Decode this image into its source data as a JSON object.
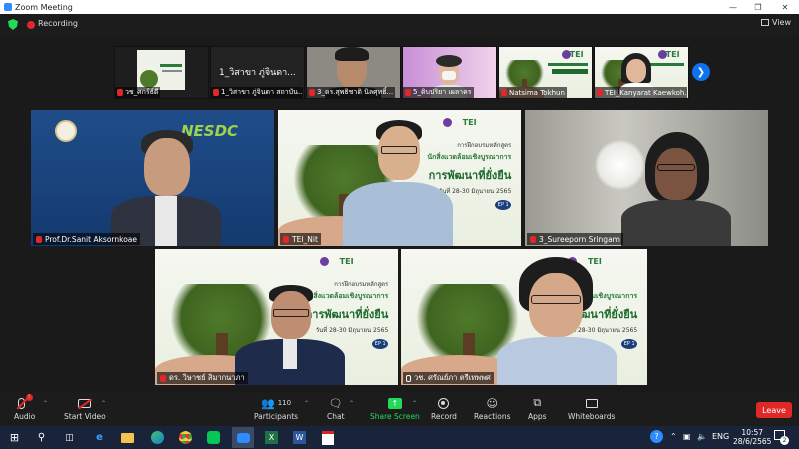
{
  "window": {
    "title": "Zoom Meeting"
  },
  "topbar": {
    "recording": "Recording",
    "view": "View"
  },
  "thumbnails": [
    {
      "name": "วช_ศกร์ธ์ดี"
    },
    {
      "name": "1_วิสาขา ภู่จินดา สถาบัน...",
      "display": "1_วิสาขา ภู่จินดา..."
    },
    {
      "name": "3_ดร.สุพธิชาติ นิลศุทธิ์..."
    },
    {
      "name": "5_ดิบปริยา เผลาคร"
    },
    {
      "name": "Natsima Tokhun"
    },
    {
      "name": "TEI_Kanyarat Kaewkoh..."
    }
  ],
  "tiles": [
    {
      "name": "Prof.Dr.Sanit Aksornkoae",
      "logo": "NESDC"
    },
    {
      "name": "TEI_Nit"
    },
    {
      "name": "3_Sureeporn Sringam"
    },
    {
      "name": "ดร. วิษาชย์ สิมากนาภา"
    },
    {
      "name": "วช. ศรัณย์ภา ตรีเทพพศ"
    }
  ],
  "slide": {
    "line1": "การฝึกอบรมหลักสูตร",
    "line2": "นักสิ่งแวดล้อมเชิงบูรณาการ",
    "line3": "การพัฒนาที่ยั่งยืน",
    "line4": "วันที่ 28-30 มิถุนายน 2565",
    "ep": "EP 1",
    "logo": "TEI"
  },
  "toolbar": {
    "audio": "Audio",
    "start_video": "Start Video",
    "participants": "Participants",
    "participant_count": "110",
    "chat": "Chat",
    "share_screen": "Share Screen",
    "record": "Record",
    "reactions": "Reactions",
    "apps": "Apps",
    "whiteboards": "Whiteboards",
    "leave": "Leave"
  },
  "taskbar": {
    "lang": "ENG",
    "time": "10:57",
    "date": "28/6/2565",
    "notifications": "2"
  },
  "colors": {
    "accent": "#0e72ed",
    "leave": "#e02828",
    "share": "#23d959",
    "active_border": "#d6e64a"
  }
}
